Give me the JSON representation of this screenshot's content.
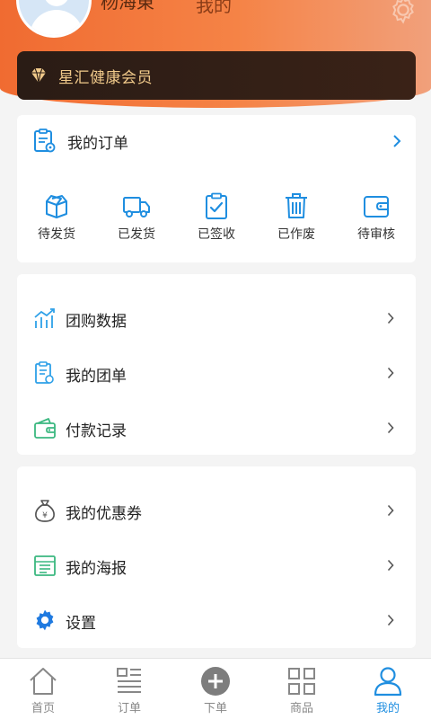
{
  "header": {
    "user_name": "杨海東",
    "page_title": "我的"
  },
  "member": {
    "label": "星汇健康会员",
    "icon": "diamond-icon"
  },
  "orders": {
    "title": "我的订单",
    "statuses": [
      {
        "label": "待发货",
        "icon": "box-icon"
      },
      {
        "label": "已发货",
        "icon": "truck-icon"
      },
      {
        "label": "已签收",
        "icon": "clipboard-check-icon"
      },
      {
        "label": "已作废",
        "icon": "trash-icon"
      },
      {
        "label": "待审核",
        "icon": "wallet-icon"
      }
    ]
  },
  "menu_group_1": [
    {
      "label": "团购数据",
      "icon": "chart-icon"
    },
    {
      "label": "我的团单",
      "icon": "document-icon"
    },
    {
      "label": "付款记录",
      "icon": "wallet-icon"
    }
  ],
  "menu_group_2": [
    {
      "label": "我的优惠券",
      "icon": "money-bag-icon"
    },
    {
      "label": "我的海报",
      "icon": "poster-icon"
    },
    {
      "label": "设置",
      "icon": "gear-icon"
    }
  ],
  "tabbar": {
    "tabs": [
      {
        "label": "首页",
        "icon": "home-icon"
      },
      {
        "label": "订单",
        "icon": "list-icon"
      },
      {
        "label": "下单",
        "icon": "plus-circle-icon"
      },
      {
        "label": "商品",
        "icon": "grid-icon"
      },
      {
        "label": "我的",
        "icon": "user-icon"
      }
    ],
    "active_index": 4
  },
  "colors": {
    "accent": "#1f8ee0",
    "header_start": "#f06b31",
    "header_end": "#f1a07b",
    "member_text": "#f0c98a",
    "member_bg": "#2a1c15"
  }
}
